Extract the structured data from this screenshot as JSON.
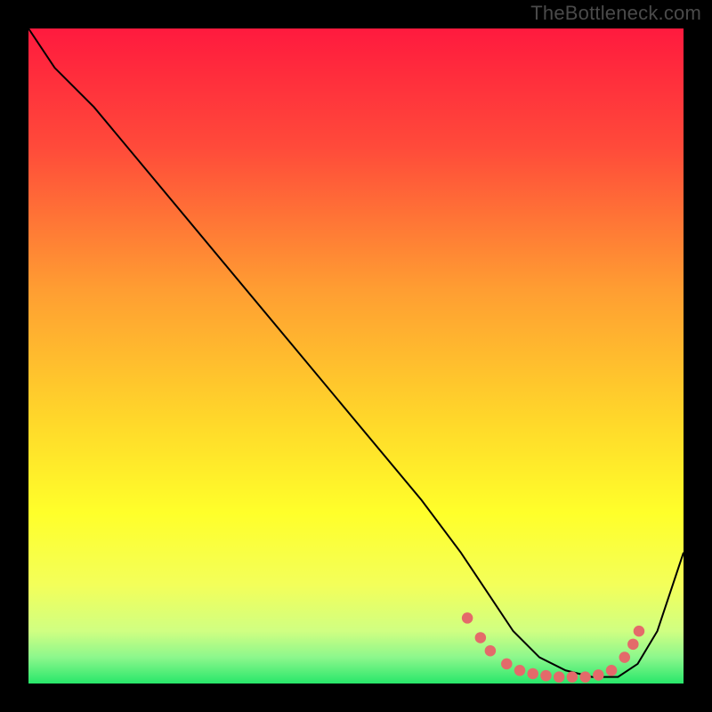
{
  "attribution": "TheBottleneck.com",
  "chart_data": {
    "type": "line",
    "title": "",
    "xlabel": "",
    "ylabel": "",
    "xlim": [
      0,
      100
    ],
    "ylim": [
      0,
      100
    ],
    "gradient_stops": [
      {
        "offset": 0,
        "color": "#ff1a3e"
      },
      {
        "offset": 18,
        "color": "#ff4a3a"
      },
      {
        "offset": 40,
        "color": "#ff9e32"
      },
      {
        "offset": 60,
        "color": "#ffd82a"
      },
      {
        "offset": 74,
        "color": "#ffff2a"
      },
      {
        "offset": 85,
        "color": "#f3ff5a"
      },
      {
        "offset": 92,
        "color": "#d0ff82"
      },
      {
        "offset": 96,
        "color": "#8cf78c"
      },
      {
        "offset": 100,
        "color": "#28e76a"
      }
    ],
    "series": [
      {
        "name": "bottleneck-curve",
        "x": [
          0,
          4,
          10,
          20,
          30,
          40,
          50,
          60,
          66,
          70,
          74,
          78,
          82,
          86,
          90,
          93,
          96,
          100
        ],
        "y": [
          100,
          94,
          88,
          76,
          64,
          52,
          40,
          28,
          20,
          14,
          8,
          4,
          2,
          1,
          1,
          3,
          8,
          20
        ]
      }
    ],
    "markers": {
      "name": "trough-markers",
      "color": "#e46a6a",
      "radius": 6,
      "points": [
        {
          "x": 67,
          "y": 10
        },
        {
          "x": 69,
          "y": 7
        },
        {
          "x": 70.5,
          "y": 5
        },
        {
          "x": 73,
          "y": 3
        },
        {
          "x": 75,
          "y": 2
        },
        {
          "x": 77,
          "y": 1.5
        },
        {
          "x": 79,
          "y": 1.2
        },
        {
          "x": 81,
          "y": 1
        },
        {
          "x": 83,
          "y": 1
        },
        {
          "x": 85,
          "y": 1
        },
        {
          "x": 87,
          "y": 1.3
        },
        {
          "x": 89,
          "y": 2
        },
        {
          "x": 91,
          "y": 4
        },
        {
          "x": 92.3,
          "y": 6
        },
        {
          "x": 93.2,
          "y": 8
        }
      ]
    }
  }
}
